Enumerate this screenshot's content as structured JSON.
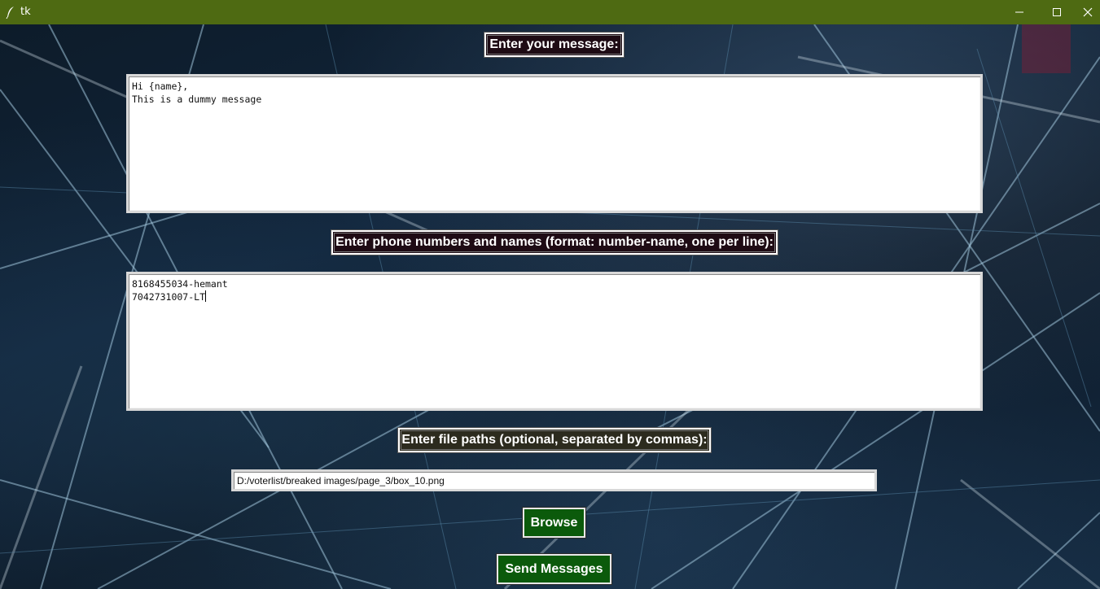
{
  "window": {
    "title": "tk",
    "app_icon": "feather-icon",
    "controls": [
      "minimize-icon",
      "maximize-icon",
      "close-icon"
    ],
    "titlebar_color": "#4e6a12"
  },
  "message_section": {
    "label": "Enter your message:",
    "lines": [
      "Hi {name},",
      "This is a dummy message"
    ]
  },
  "phones_section": {
    "label": "Enter phone numbers and names (format: number-name, one per line):",
    "lines": [
      "8168455034-hemant",
      "7042731007-LT"
    ]
  },
  "files_section": {
    "label": "Enter file paths (optional, separated by commas):",
    "value": "D:/voterlist/breaked images/page_3/box_10.png"
  },
  "buttons": {
    "browse": "Browse",
    "send": "Send Messages",
    "color": "#0b5a0b"
  }
}
